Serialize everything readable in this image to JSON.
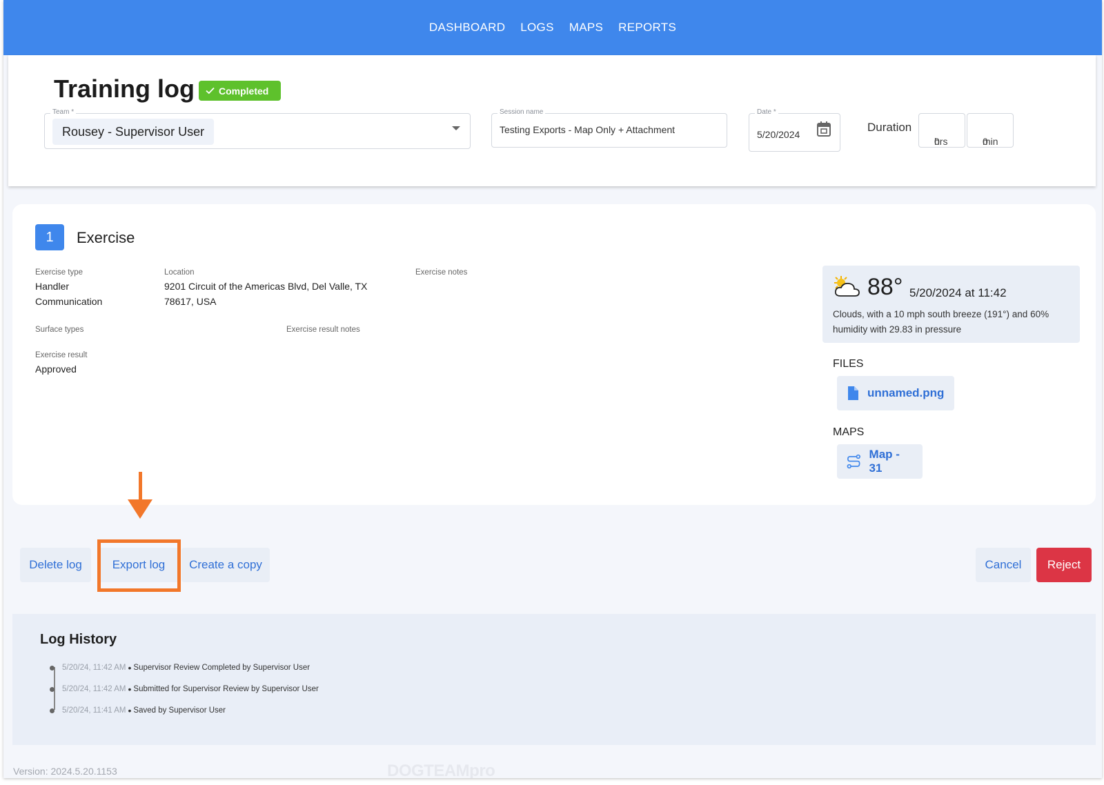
{
  "nav": {
    "items": [
      {
        "label": "DASHBOARD"
      },
      {
        "label": "LOGS"
      },
      {
        "label": "MAPS"
      },
      {
        "label": "REPORTS"
      }
    ]
  },
  "header": {
    "title": "Training log",
    "status_badge": "Completed",
    "team": {
      "label": "Team *",
      "value": "Rousey - Supervisor User"
    },
    "session": {
      "label": "Session name",
      "value": "Testing Exports - Map Only + Attachment"
    },
    "date": {
      "label": "Date *",
      "value": "5/20/2024"
    },
    "duration": {
      "label": "Duration",
      "hours": "0",
      "hours_unit": "hrs",
      "minutes": "0",
      "minutes_unit": "min"
    }
  },
  "exercise": {
    "number": "1",
    "title": "Exercise",
    "exercise_type": {
      "label": "Exercise type",
      "value_line1": "Handler",
      "value_line2": "Communication"
    },
    "location": {
      "label": "Location",
      "value_line1": "9201 Circuit of the Americas Blvd, Del Valle, TX",
      "value_line2": "78617, USA"
    },
    "exercise_notes": {
      "label": "Exercise notes"
    },
    "surface_types": {
      "label": "Surface types"
    },
    "exercise_result_notes": {
      "label": "Exercise result notes"
    },
    "exercise_result": {
      "label": "Exercise result",
      "value": "Approved"
    },
    "weather": {
      "icon": "partly-cloudy-icon",
      "temperature": "88°",
      "timestamp": "5/20/2024 at 11:42",
      "description": "Clouds, with a 10 mph south breeze (191°) and 60% humidity with 29.83 in pressure"
    },
    "files": {
      "heading": "FILES",
      "items": [
        {
          "name": "unnamed.png",
          "icon": "file-icon"
        }
      ]
    },
    "maps": {
      "heading": "MAPS",
      "items": [
        {
          "name": "Map - 31",
          "icon": "route-icon"
        }
      ]
    }
  },
  "actions": {
    "delete": "Delete log",
    "export": "Export log",
    "copy": "Create a copy",
    "cancel": "Cancel",
    "reject": "Reject"
  },
  "history": {
    "title": "Log History",
    "entries": [
      {
        "time": "5/20/24, 11:42 AM",
        "text": "Supervisor Review Completed by Supervisor User"
      },
      {
        "time": "5/20/24, 11:42 AM",
        "text": "Submitted for Supervisor Review by Supervisor User"
      },
      {
        "time": "5/20/24, 11:41 AM",
        "text": "Saved by Supervisor User"
      }
    ]
  },
  "footer": {
    "version": "Version: 2024.5.20.1153",
    "watermark": "DOGTEAMpro"
  },
  "colors": {
    "primary": "#3f87ec",
    "link": "#2f6fd6",
    "success": "#5ec12c",
    "danger": "#dc3545",
    "annotation": "#f2772a"
  }
}
